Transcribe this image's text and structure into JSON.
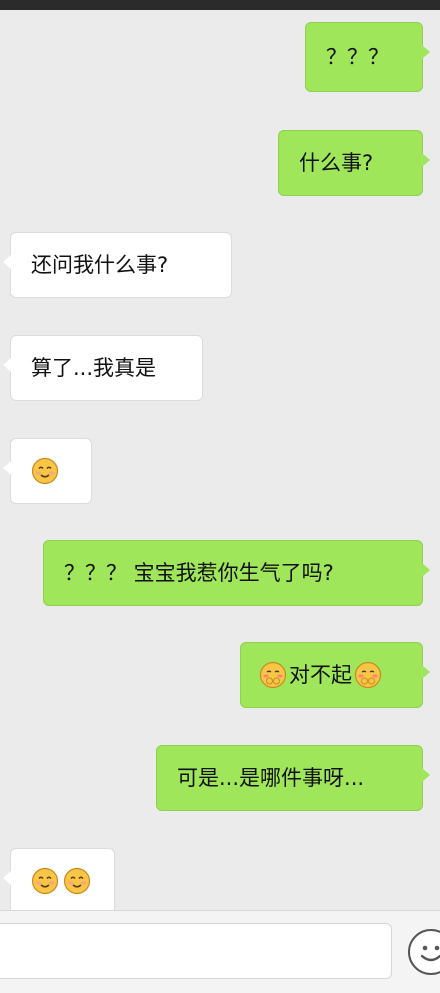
{
  "chat": {
    "messages": [
      {
        "side": "sent",
        "text": "？？？",
        "emoji": []
      },
      {
        "side": "sent",
        "text": "什么事?",
        "emoji": []
      },
      {
        "side": "received",
        "text": "还问我什么事?",
        "emoji": []
      },
      {
        "side": "received",
        "text": "算了...我真是",
        "emoji": []
      },
      {
        "side": "received",
        "text": "",
        "emoji": [
          "smile-emoji"
        ]
      },
      {
        "side": "sent",
        "text": "？？？ 宝宝我惹你生气了吗?",
        "emoji": []
      },
      {
        "side": "sent",
        "text": "对不起",
        "emoji": [
          "shy-emoji-leading",
          "shy-emoji-trailing"
        ]
      },
      {
        "side": "sent",
        "text": "可是...是哪件事呀...",
        "emoji": []
      },
      {
        "side": "received",
        "text": "",
        "emoji": [
          "smile-emoji",
          "smile-emoji"
        ]
      }
    ]
  },
  "input": {
    "value": "",
    "placeholder": ""
  },
  "toolbar": {
    "emoji_button_icon": "smiley-icon"
  },
  "colors": {
    "sent_bubble": "#9fe65a",
    "received_bubble": "#ffffff",
    "background": "#ebebeb"
  }
}
